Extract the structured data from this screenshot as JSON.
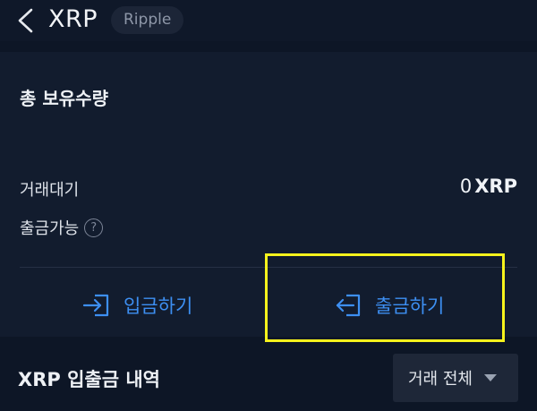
{
  "header": {
    "title": "XRP",
    "badge": "Ripple"
  },
  "holdings": {
    "section_title": "총 보유수량",
    "pending_label": "거래대기",
    "pending_value": "0",
    "pending_unit": "XRP",
    "withdrawable_label": "출금가능",
    "help_symbol": "?"
  },
  "actions": {
    "deposit_label": "입금하기",
    "withdraw_label": "출금하기"
  },
  "history": {
    "title": "XRP 입출금 내역",
    "filter_label": "거래 전체"
  },
  "colors": {
    "accent": "#3d8ff2",
    "highlight": "#f6f21c",
    "background": "#0d1626"
  },
  "icons": {
    "back": "chevron-left-icon",
    "help": "question-circle-icon",
    "deposit": "login-arrow-icon",
    "withdraw": "logout-arrow-icon",
    "caret": "caret-down-icon"
  }
}
